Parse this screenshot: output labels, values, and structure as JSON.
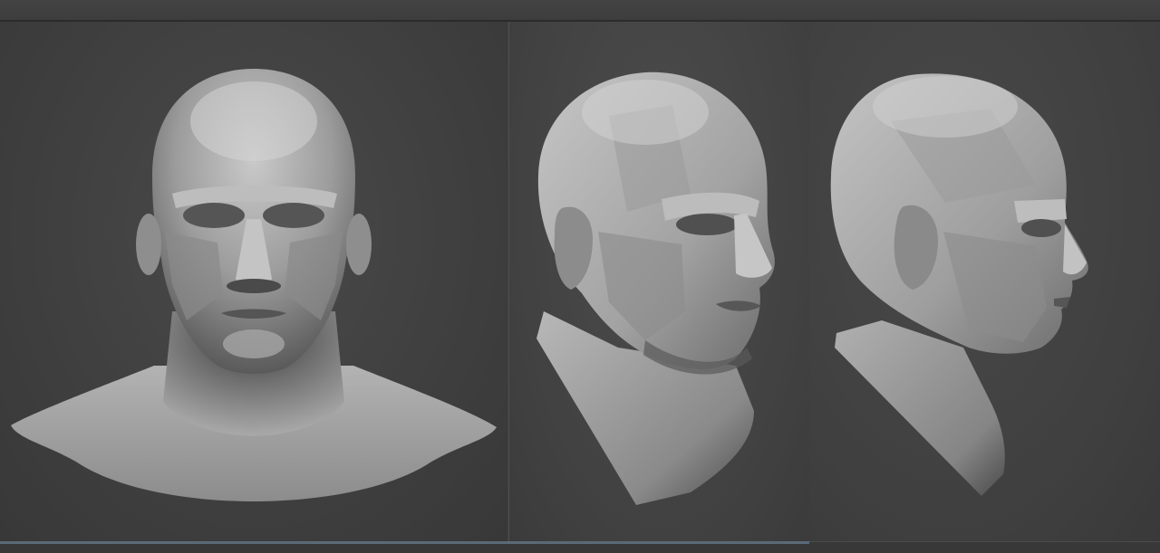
{
  "scene": {
    "background_color": "#3e3e3e",
    "mesh_color": "#b8b8b8",
    "shadow_color": "#2a2a2a",
    "views": [
      {
        "view": "front",
        "icon": "head-front-icon"
      },
      {
        "view": "three-quarter",
        "icon": "head-three-quarter-icon"
      },
      {
        "view": "profile",
        "icon": "head-profile-icon"
      }
    ]
  }
}
